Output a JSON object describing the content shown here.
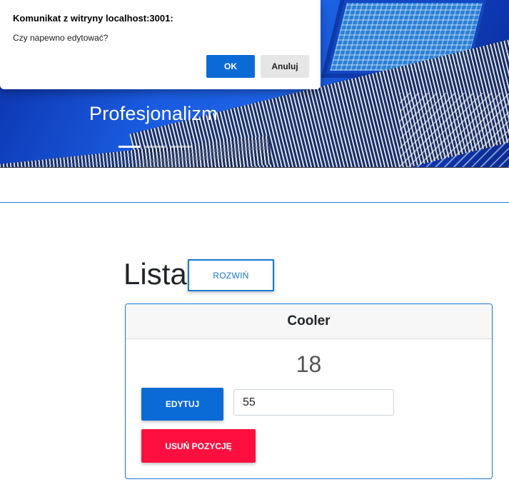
{
  "hero": {
    "caption": "Profesjonalizm",
    "indicators": [
      {
        "active": true
      },
      {
        "active": false
      },
      {
        "active": false
      }
    ]
  },
  "dialog": {
    "title": "Komunikat z witryny localhost:3001:",
    "message": "Czy napewno edytować?",
    "ok_label": "OK",
    "cancel_label": "Anuluj"
  },
  "list": {
    "title": "Lista",
    "expand_label": "ROZWIŃ",
    "card": {
      "name": "Cooler",
      "quantity": "18",
      "edit_label": "EDYTUJ",
      "input_value": "55",
      "delete_label": "USUŃ POZYCJĘ"
    }
  },
  "colors": {
    "accent": "#0a6bd6",
    "danger": "#ff0f3f",
    "border_accent": "#1b75d0"
  }
}
